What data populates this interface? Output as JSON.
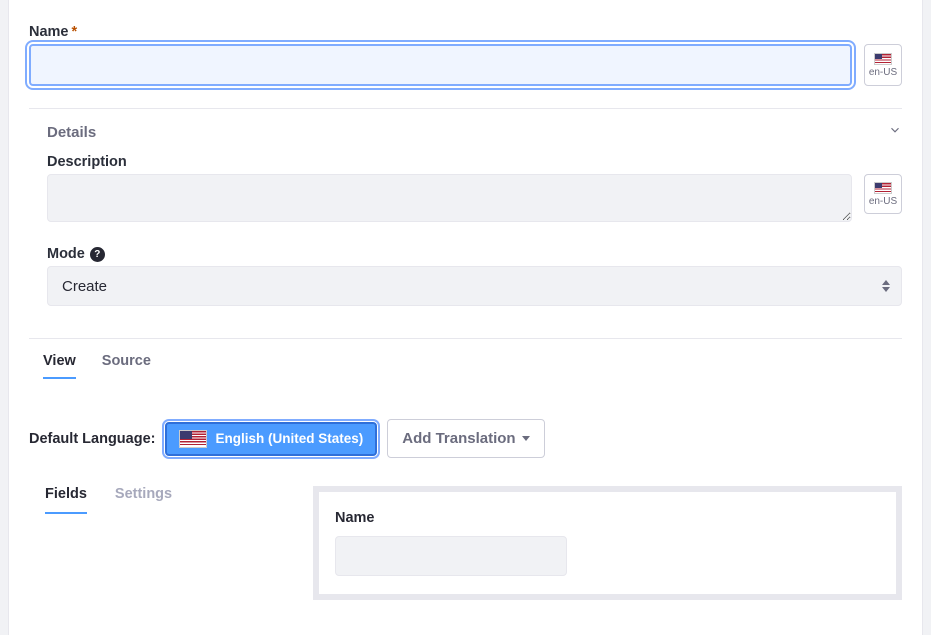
{
  "fields": {
    "name": {
      "label": "Name",
      "value": "",
      "required": true,
      "locale_code": "en-US"
    },
    "description": {
      "label": "Description",
      "value": "",
      "locale_code": "en-US"
    },
    "mode": {
      "label": "Mode",
      "value": "Create",
      "help": "?"
    }
  },
  "details": {
    "label": "Details",
    "expanded": true
  },
  "editor_tabs": {
    "view": "View",
    "source": "Source",
    "active": "view"
  },
  "language": {
    "default_label": "Default Language:",
    "default_button": "English (United States)",
    "add_translation": "Add Translation"
  },
  "builder_tabs": {
    "fields": "Fields",
    "settings": "Settings",
    "active": "fields"
  },
  "preview": {
    "name_label": "Name",
    "name_value": ""
  }
}
